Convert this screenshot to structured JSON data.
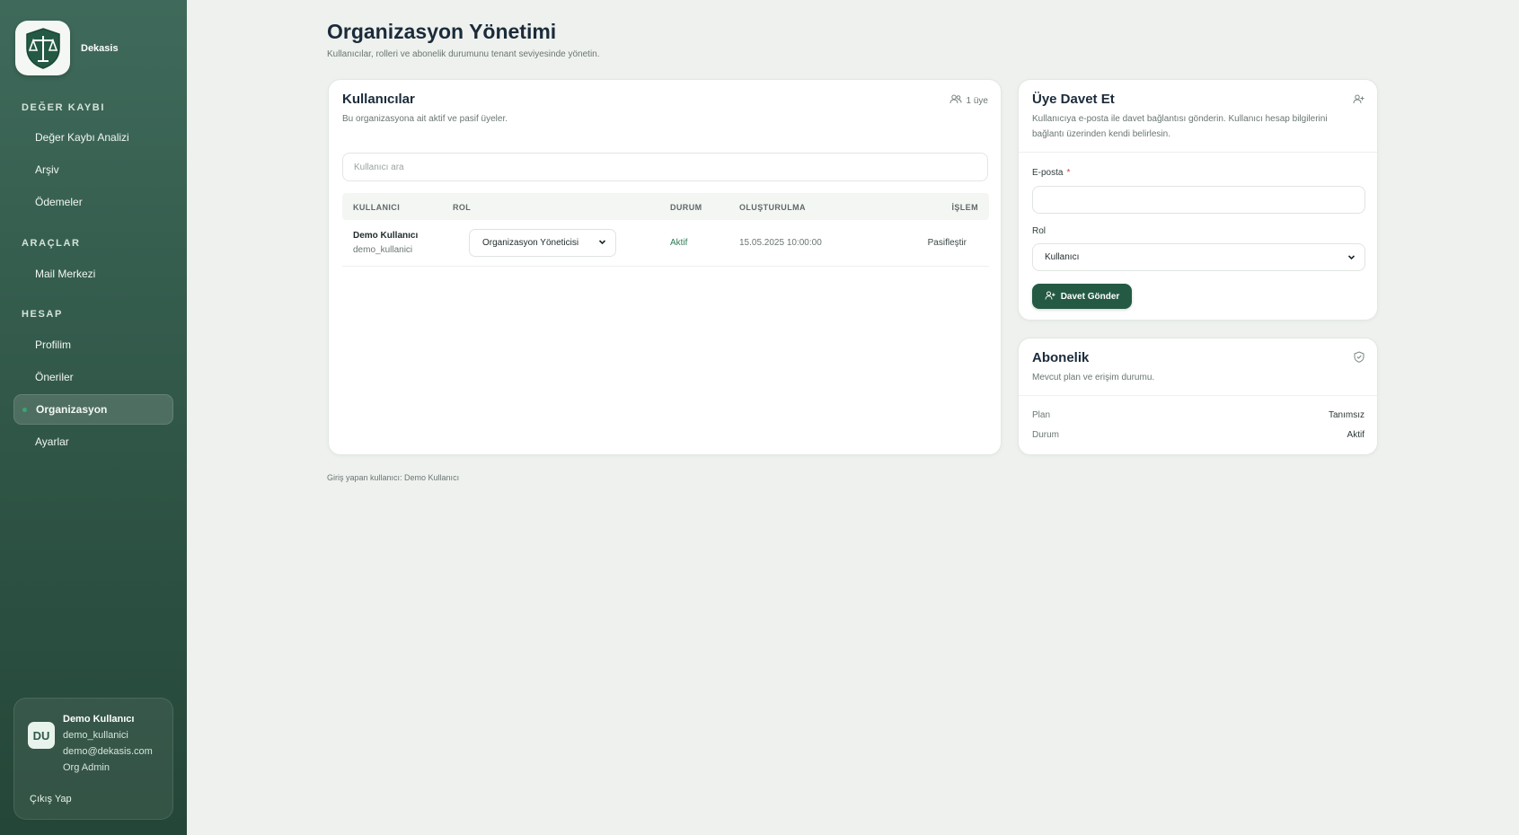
{
  "brand": {
    "name": "Dekasis",
    "logo_icon": "shield-scales-icon"
  },
  "nav": {
    "sections": [
      {
        "label": "DEĞER KAYBI",
        "items": [
          "Değer Kaybı Analizi",
          "Arşiv",
          "Ödemeler"
        ]
      },
      {
        "label": "ARAÇLAR",
        "items": [
          "Mail Merkezi"
        ]
      },
      {
        "label": "HESAP",
        "items": [
          "Profilim",
          "Öneriler",
          "Organizasyon",
          "Ayarlar"
        ]
      }
    ],
    "active": "Organizasyon"
  },
  "user": {
    "initials": "DU",
    "name": "Demo Kullanıcı",
    "username": "demo_kullanici",
    "email": "demo@dekasis.com",
    "role": "Org Admin",
    "logout_label": "Çıkış Yap"
  },
  "page": {
    "title": "Organizasyon Yönetimi",
    "subtitle": "Kullanıcılar, rolleri ve abonelik durumunu tenant seviyesinde yönetin."
  },
  "users_card": {
    "title": "Kullanıcılar",
    "description": "Bu organizasyona ait aktif ve pasif üyeler.",
    "member_count": "1 üye",
    "search_placeholder": "Kullanıcı ara",
    "columns": [
      "KULLANICI",
      "ROL",
      "DURUM",
      "OLUŞTURULMA",
      "İŞLEM"
    ],
    "rows": [
      {
        "name": "Demo Kullanıcı",
        "username": "demo_kullanici",
        "role": "Organizasyon Yöneticisi",
        "status": "Aktif",
        "created": "15.05.2025 10:00:00",
        "action": "Pasifleştir"
      }
    ]
  },
  "invite_card": {
    "title": "Üye Davet Et",
    "description": "Kullanıcıya e-posta ile davet bağlantısı gönderin. Kullanıcı hesap bilgilerini bağlantı üzerinden kendi belirlesin.",
    "email_label": "E-posta",
    "required_mark": "*",
    "email_value": "",
    "role_label": "Rol",
    "role_value": "Kullanıcı",
    "submit_label": "Davet Gönder"
  },
  "subscription_card": {
    "title": "Abonelik",
    "description": "Mevcut plan ve erişim durumu.",
    "plan_label": "Plan",
    "plan_value": "Tanımsız",
    "status_label": "Durum",
    "status_value": "Aktif"
  },
  "footer": {
    "logged_in": "Giriş yapan kullanıcı: Demo Kullanıcı"
  },
  "colors": {
    "sidebar": "#2f5546",
    "primary_button": "#245a44",
    "status_active": "#2e7a57",
    "background": "#eef1ee"
  }
}
